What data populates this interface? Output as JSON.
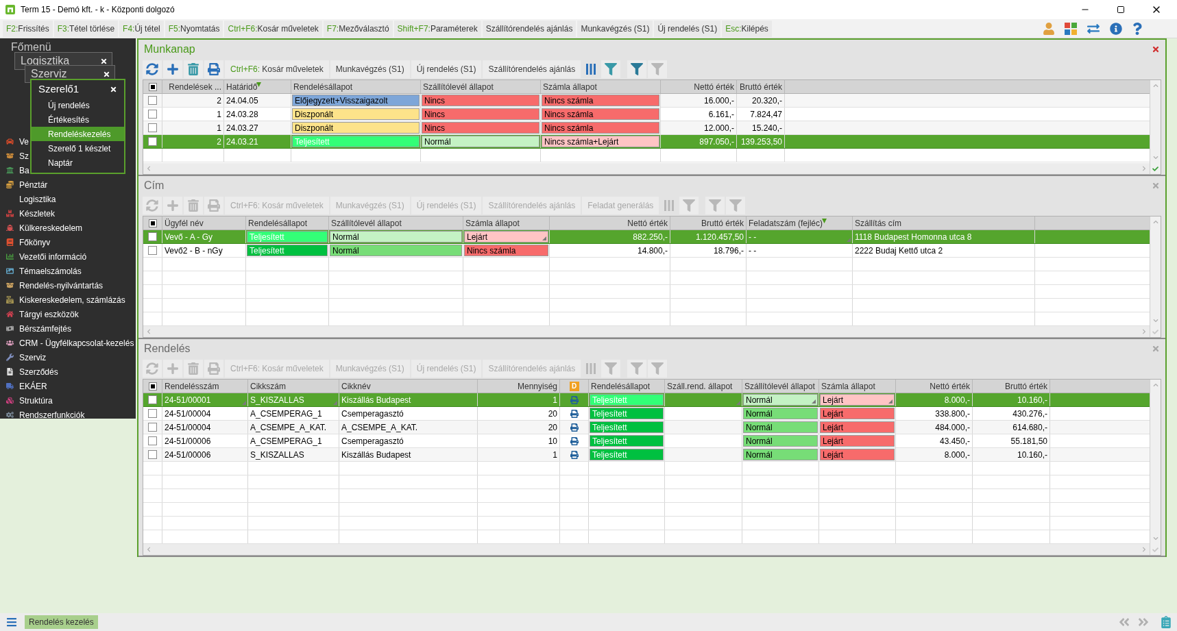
{
  "window": {
    "title": "Term 15 - Demó kft. - k - Központi dolgozó"
  },
  "function_bar": [
    {
      "key": "F2:",
      "label": "Frissítés"
    },
    {
      "key": "F3:",
      "label": "Tétel törlése"
    },
    {
      "key": "F4:",
      "label": "Új tétel"
    },
    {
      "key": "F5:",
      "label": "Nyomtatás"
    },
    {
      "key": "Ctrl+F6:",
      "label": "Kosár műveletek"
    },
    {
      "key": "F7:",
      "label": "Mezőválasztó"
    },
    {
      "key": "Shift+F7:",
      "label": "Paraméterek"
    },
    {
      "label": "Szállítórendelés ajánlás"
    },
    {
      "label": "Munkavégzés (S1)"
    },
    {
      "label": "Új rendelés (S1)"
    },
    {
      "key": "Esc:",
      "label": "Kilépés"
    }
  ],
  "sidebar": {
    "title": "Főmenü",
    "stacked_windows": [
      {
        "title": "Logisztika"
      },
      {
        "title": "Szerviz"
      }
    ],
    "popup": {
      "title": "Szerelő1",
      "items": [
        {
          "label": "Új rendelés",
          "selected": false
        },
        {
          "label": "Értékesítés",
          "selected": false
        },
        {
          "label": "Rendeléskezelés",
          "selected": true
        },
        {
          "label": "Szerelő 1 készlet",
          "selected": false
        },
        {
          "label": "Naptár",
          "selected": false
        }
      ]
    },
    "items": [
      {
        "label": "Ve"
      },
      {
        "label": "Sz"
      },
      {
        "label": "Ba"
      },
      {
        "label": "Pénztár"
      },
      {
        "label": "Logisztika"
      },
      {
        "label": "Készletek"
      },
      {
        "label": "Külkereskedelem"
      },
      {
        "label": "Főkönyv"
      },
      {
        "label": "Vezetői információ"
      },
      {
        "label": "Témaelszámolás"
      },
      {
        "label": "Rendelés-nyilvántartás"
      },
      {
        "label": "Kiskereskedelem, számlázás"
      },
      {
        "label": "Tárgyi eszközök"
      },
      {
        "label": "Bérszámfejtés"
      },
      {
        "label": "CRM - Ügyfélkapcsolat-kezelés"
      },
      {
        "label": "Szerviz"
      },
      {
        "label": "Szerződés"
      },
      {
        "label": "EKÁER"
      },
      {
        "label": "Struktúra"
      },
      {
        "label": "Rendszerfunkciók"
      }
    ]
  },
  "panels": [
    {
      "title": "Munkanap",
      "active": true,
      "select_all": {
        "checked": true
      },
      "toolbar": [
        {
          "key": "Ctrl+F6:",
          "label": "Kosár műveletek",
          "disabled": false
        },
        {
          "label": "Munkavégzés (S1)",
          "disabled": false
        },
        {
          "label": "Új rendelés (S1)",
          "disabled": false
        },
        {
          "label": "Szállítórendelés ajánlás",
          "disabled": false
        }
      ],
      "columns": [
        {
          "label": "Rendelések ...",
          "kind": "number",
          "sorted": false
        },
        {
          "label": "Határidő",
          "kind": "text",
          "sorted": true
        },
        {
          "label": "Rendelésállapot",
          "kind": "text",
          "sorted": false
        },
        {
          "label": "Szállítólevél állapot",
          "kind": "text",
          "sorted": false
        },
        {
          "label": "Számla állapot",
          "kind": "text",
          "sorted": false
        },
        {
          "label": "Nettó érték",
          "kind": "number",
          "sorted": false
        },
        {
          "label": "Bruttó érték",
          "kind": "number",
          "sorted": false
        }
      ],
      "rows": [
        {
          "selected": false,
          "checked": false,
          "cells": [
            {
              "text": "2"
            },
            {
              "text": "24.04.05"
            },
            {
              "text": "Előjegyzett+Visszaigazolt",
              "color": "#7ea6d8"
            },
            {
              "text": "Nincs",
              "color": "#f76b6b"
            },
            {
              "text": "Nincs számla",
              "color": "#f76b6b"
            },
            {
              "text": "16.000,-"
            },
            {
              "text": "20.320,-"
            }
          ]
        },
        {
          "selected": false,
          "checked": false,
          "cells": [
            {
              "text": "1"
            },
            {
              "text": "24.03.28"
            },
            {
              "text": "Diszponált",
              "color": "#fde38a"
            },
            {
              "text": "Nincs",
              "color": "#f76b6b"
            },
            {
              "text": "Nincs számla",
              "color": "#f76b6b"
            },
            {
              "text": "6.161,-"
            },
            {
              "text": "7.824,47"
            }
          ]
        },
        {
          "selected": false,
          "checked": false,
          "cells": [
            {
              "text": "1"
            },
            {
              "text": "24.03.27"
            },
            {
              "text": "Diszponált",
              "color": "#fde38a"
            },
            {
              "text": "Nincs",
              "color": "#f76b6b"
            },
            {
              "text": "Nincs számla",
              "color": "#f76b6b"
            },
            {
              "text": "12.000,-"
            },
            {
              "text": "15.240,-"
            }
          ]
        },
        {
          "selected": true,
          "checked": false,
          "cells": [
            {
              "text": "2"
            },
            {
              "text": "24.03.21"
            },
            {
              "text": "Teljesített",
              "color": "#33ff77"
            },
            {
              "text": "Normál",
              "color": "#c4f2c4"
            },
            {
              "text": "Nincs számla+Lejárt",
              "color": "#ffc4c4"
            },
            {
              "text": "897.050,-"
            },
            {
              "text": "139.253,50"
            }
          ]
        }
      ]
    },
    {
      "title": "Cím",
      "active": false,
      "select_all": {
        "checked": true
      },
      "toolbar": [
        {
          "key": "Ctrl+F6:",
          "label": "Kosár műveletek",
          "disabled": true
        },
        {
          "label": "Munkavégzés (S1)",
          "disabled": true
        },
        {
          "label": "Új rendelés (S1)",
          "disabled": true
        },
        {
          "label": "Szállítórendelés ajánlás",
          "disabled": true
        },
        {
          "label": "Feladat generálás",
          "disabled": true
        }
      ],
      "columns": [
        {
          "label": "Ügyfél név",
          "kind": "text",
          "sorted": false
        },
        {
          "label": "Rendelésállapot",
          "kind": "text",
          "sorted": false
        },
        {
          "label": "Szállítólevél állapot",
          "kind": "text",
          "sorted": false
        },
        {
          "label": "Számla állapot",
          "kind": "text",
          "sorted": false
        },
        {
          "label": "Nettó érték",
          "kind": "number",
          "sorted": false
        },
        {
          "label": "Bruttó érték",
          "kind": "number",
          "sorted": false
        },
        {
          "label": "Feladatszám (fejléc)",
          "kind": "text",
          "sorted": true
        },
        {
          "label": "Szállítás cím",
          "kind": "text",
          "sorted": false
        }
      ],
      "rows": [
        {
          "selected": true,
          "checked": false,
          "cells": [
            {
              "text": "Vevő - A - Gy"
            },
            {
              "text": "Teljesített",
              "color": "#33ff77"
            },
            {
              "text": "Normál",
              "color": "#c4f2c4"
            },
            {
              "text": "Lejárt",
              "color": "#ffc4c4",
              "dropdown": true
            },
            {
              "text": "882.250,-"
            },
            {
              "text": "1.120.457,50"
            },
            {
              "text": "- -",
              "dropdown": true
            },
            {
              "text": "1118 Budapest Homonna utca 8"
            }
          ]
        },
        {
          "selected": false,
          "checked": false,
          "cells": [
            {
              "text": "Vevő2 - B - nGy"
            },
            {
              "text": "Teljesített",
              "color": "#00c040"
            },
            {
              "text": "Normál",
              "color": "#77dd77"
            },
            {
              "text": "Nincs számla",
              "color": "#f76b6b"
            },
            {
              "text": "14.800,-"
            },
            {
              "text": "18.796,-"
            },
            {
              "text": "- -"
            },
            {
              "text": "2222 Budaj Kettő utca 2"
            }
          ]
        }
      ]
    },
    {
      "title": "Rendelés",
      "active": false,
      "select_all": {
        "checked": true
      },
      "toolbar": [
        {
          "key": "Ctrl+F6:",
          "label": "Kosár műveletek",
          "disabled": true
        },
        {
          "label": "Munkavégzés (S1)",
          "disabled": true
        },
        {
          "label": "Új rendelés (S1)",
          "disabled": true
        },
        {
          "label": "Szállítórendelés ajánlás",
          "disabled": true
        }
      ],
      "columns": [
        {
          "label": "Rendelésszám",
          "kind": "text",
          "sorted": false
        },
        {
          "label": "Cikkszám",
          "kind": "text",
          "sorted": false
        },
        {
          "label": "Cikknév",
          "kind": "text",
          "sorted": false
        },
        {
          "label": "Mennyiség",
          "kind": "number",
          "sorted": false
        },
        {
          "label": "D",
          "kind": "badge"
        },
        {
          "label": "Rendelésállapot",
          "kind": "text",
          "sorted": false
        },
        {
          "label": "Száll.rend. állapot",
          "kind": "text",
          "sorted": false
        },
        {
          "label": "Szállítólevél állapot",
          "kind": "text",
          "sorted": false
        },
        {
          "label": "Számla állapot",
          "kind": "text",
          "sorted": false
        },
        {
          "label": "Nettó érték",
          "kind": "number",
          "sorted": false
        },
        {
          "label": "Bruttó érték",
          "kind": "number",
          "sorted": false
        }
      ],
      "rows": [
        {
          "selected": true,
          "checked": false,
          "cells": [
            {
              "text": "24-51/00001",
              "dropdown": true
            },
            {
              "text": "S_KISZALLAS",
              "dropdown": true
            },
            {
              "text": "Kiszállás Budapest"
            },
            {
              "text": "1"
            },
            {
              "kind": "icon"
            },
            {
              "text": "Teljesített",
              "color": "#33ff77"
            },
            {
              "dropdown": true
            },
            {
              "text": "Normál",
              "color": "#c4f2c4",
              "dropdown": true
            },
            {
              "text": "Lejárt",
              "color": "#ffc4c4",
              "dropdown": true
            },
            {
              "text": "8.000,-"
            },
            {
              "text": "10.160,-"
            }
          ]
        },
        {
          "selected": false,
          "checked": false,
          "cells": [
            {
              "text": "24-51/00004"
            },
            {
              "text": "A_CSEMPERAG_1"
            },
            {
              "text": "Csemperagasztó"
            },
            {
              "text": "20"
            },
            {
              "kind": "icon"
            },
            {
              "text": "Teljesített",
              "color": "#00c040"
            },
            {},
            {
              "text": "Normál",
              "color": "#77dd77"
            },
            {
              "text": "Lejárt",
              "color": "#f76b6b"
            },
            {
              "text": "338.800,-"
            },
            {
              "text": "430.276,-"
            }
          ]
        },
        {
          "selected": false,
          "checked": false,
          "cells": [
            {
              "text": "24-51/00004"
            },
            {
              "text": "A_CSEMPE_A_KAT."
            },
            {
              "text": "A_CSEMPE_A_KAT."
            },
            {
              "text": "20"
            },
            {
              "kind": "icon"
            },
            {
              "text": "Teljesített",
              "color": "#00c040"
            },
            {},
            {
              "text": "Normál",
              "color": "#77dd77"
            },
            {
              "text": "Lejárt",
              "color": "#f76b6b"
            },
            {
              "text": "484.000,-"
            },
            {
              "text": "614.680,-"
            }
          ]
        },
        {
          "selected": false,
          "checked": false,
          "cells": [
            {
              "text": "24-51/00006"
            },
            {
              "text": "A_CSEMPERAG_1"
            },
            {
              "text": "Csemperagasztó"
            },
            {
              "text": "10"
            },
            {
              "kind": "icon"
            },
            {
              "text": "Teljesített",
              "color": "#00c040"
            },
            {},
            {
              "text": "Normál",
              "color": "#77dd77"
            },
            {
              "text": "Lejárt",
              "color": "#f76b6b"
            },
            {
              "text": "43.450,-"
            },
            {
              "text": "55.181,50"
            }
          ]
        },
        {
          "selected": false,
          "checked": false,
          "cells": [
            {
              "text": "24-51/00006"
            },
            {
              "text": "S_KISZALLAS"
            },
            {
              "text": "Kiszállás Budapest"
            },
            {
              "text": "1"
            },
            {
              "kind": "icon"
            },
            {
              "text": "Teljesített",
              "color": "#00c040"
            },
            {},
            {
              "text": "Normál",
              "color": "#77dd77"
            },
            {
              "text": "Lejárt",
              "color": "#f76b6b"
            },
            {
              "text": "8.000,-"
            },
            {
              "text": "10.160,-"
            }
          ]
        }
      ]
    }
  ],
  "status_bar": {
    "tabs": [
      {
        "label": "Rendelés kezelés",
        "selected": true
      }
    ]
  }
}
